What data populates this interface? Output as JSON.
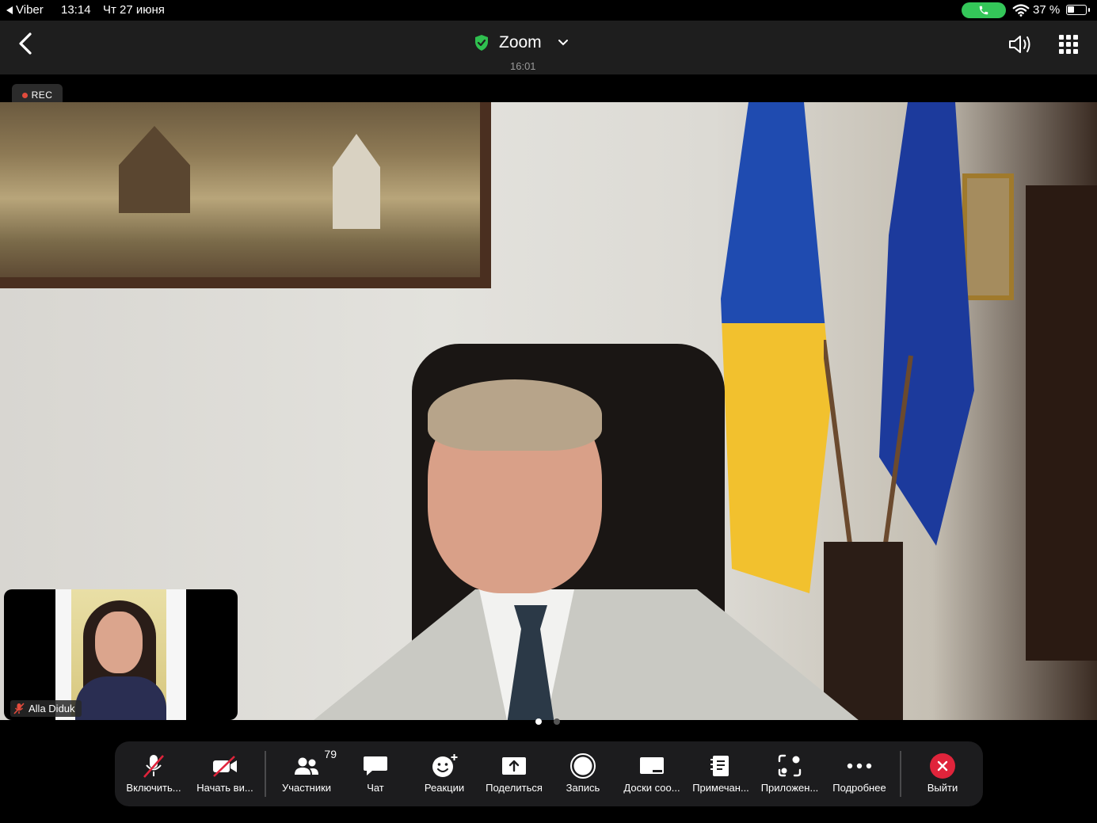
{
  "status_bar": {
    "back_app": "Viber",
    "time": "13:14",
    "date": "Чт 27 июня",
    "battery_percent": "37 %",
    "battery_level": 0.37,
    "call_active_color": "#34c759"
  },
  "header": {
    "title": "Zoom",
    "meeting_time": "16:01",
    "icons": [
      "back-chevron-icon",
      "shield-check-icon",
      "chevron-down-icon",
      "speaker-icon",
      "grid-icon"
    ],
    "shield_color": "#2fbf4f"
  },
  "video": {
    "rec_label": "REC",
    "rec_color": "#e14b3c"
  },
  "thumbnail": {
    "participant_name": "Alla Diduk",
    "muted": true
  },
  "pager": {
    "pages": 2,
    "active_page": 1
  },
  "toolbar": {
    "buttons": [
      {
        "label": "Включить...",
        "icon": "mic-muted-icon"
      },
      {
        "label": "Начать ви...",
        "icon": "video-off-icon"
      },
      {
        "label": "Участники",
        "icon": "participants-icon",
        "badge": "79"
      },
      {
        "label": "Чат",
        "icon": "chat-icon"
      },
      {
        "label": "Реакции",
        "icon": "reaction-smiley-icon"
      },
      {
        "label": "Поделиться",
        "icon": "share-screen-icon"
      },
      {
        "label": "Запись",
        "icon": "record-icon"
      },
      {
        "label": "Доски соо...",
        "icon": "whiteboard-icon"
      },
      {
        "label": "Примечан...",
        "icon": "notes-icon"
      },
      {
        "label": "Приложен...",
        "icon": "apps-icon"
      },
      {
        "label": "Подробнее",
        "icon": "more-dots-icon"
      },
      {
        "label": "Выйти",
        "icon": "leave-icon"
      }
    ],
    "leave_color": "#e0243b"
  }
}
